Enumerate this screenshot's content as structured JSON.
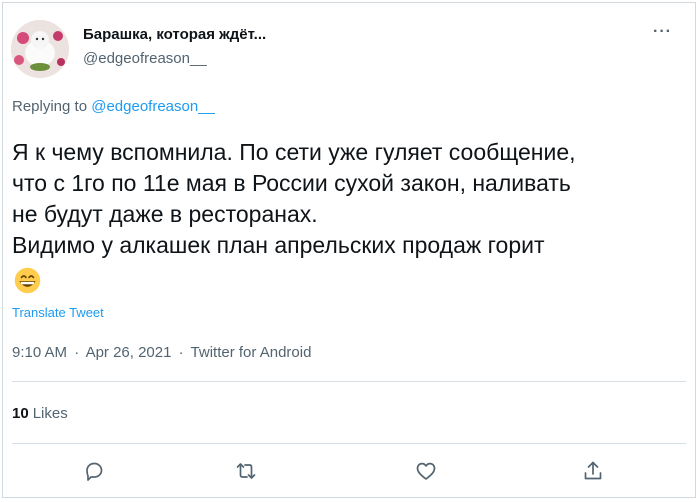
{
  "author": {
    "display_name": "Барашка, которая ждёт...",
    "handle": "@edgeofreason__"
  },
  "reply": {
    "prefix": "Replying to",
    "to_handle": "@edgeofreason__"
  },
  "tweet": {
    "lines": [
      "Я к чему вспомнила. По сети уже гуляет сообщение,",
      "что с 1го по 11е мая в России сухой закон, наливать",
      "не будут даже в ресторанах.",
      "Видимо у алкашек план апрельских продаж горит"
    ],
    "emoji": "grinning-face-with-smiling-eyes"
  },
  "translate_label": "Translate Tweet",
  "meta": {
    "time": "9:10 AM",
    "date": "Apr 26, 2021",
    "source": "Twitter for Android",
    "separator": "·"
  },
  "stats": {
    "likes_count": "10",
    "likes_label": "Likes"
  },
  "actions": [
    {
      "name": "reply-icon"
    },
    {
      "name": "retweet-icon"
    },
    {
      "name": "like-icon"
    },
    {
      "name": "share-icon"
    }
  ],
  "colors": {
    "accent": "#1d9bf0",
    "text": "#0f1419",
    "secondary": "#536471",
    "border": "#cfd9de"
  }
}
